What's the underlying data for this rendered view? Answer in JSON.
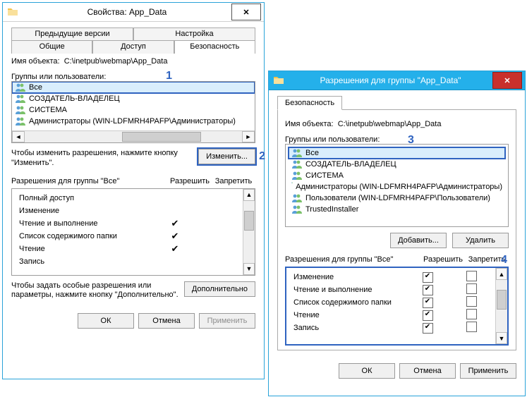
{
  "left": {
    "title": "Свойства: App_Data",
    "tabs_top": [
      "Предыдущие версии",
      "Настройка"
    ],
    "tabs_bottom": [
      "Общие",
      "Доступ",
      "Безопасность"
    ],
    "object_label": "Имя объекта:",
    "object_path": "C:\\inetpub\\webmap\\App_Data",
    "groups_label": "Группы или пользователи:",
    "groups": [
      "Все",
      "СОЗДАТЕЛЬ-ВЛАДЕЛЕЦ",
      "СИСТЕМА",
      "Администраторы (WIN-LDFMRH4PAFP\\Администраторы)"
    ],
    "change_note": "Чтобы изменить разрешения, нажмите кнопку \"Изменить\".",
    "change_btn": "Изменить...",
    "perm_label": "Разрешения для группы \"Все\"",
    "allow": "Разрешить",
    "deny": "Запретить",
    "perms": [
      {
        "name": "Полный доступ",
        "allow": false
      },
      {
        "name": "Изменение",
        "allow": false
      },
      {
        "name": "Чтение и выполнение",
        "allow": true
      },
      {
        "name": "Список содержимого папки",
        "allow": true
      },
      {
        "name": "Чтение",
        "allow": true
      },
      {
        "name": "Запись",
        "allow": false
      }
    ],
    "adv_note": "Чтобы задать особые разрешения или параметры, нажмите кнопку \"Дополнительно\".",
    "adv_btn": "Дополнительно",
    "ok": "ОК",
    "cancel": "Отмена",
    "apply": "Применить"
  },
  "right": {
    "title": "Разрешения для группы \"App_Data\"",
    "tab": "Безопасность",
    "object_label": "Имя объекта:",
    "object_path": "C:\\inetpub\\webmap\\App_Data",
    "groups_label": "Группы или пользователи:",
    "groups": [
      "Все",
      "СОЗДАТЕЛЬ-ВЛАДЕЛЕЦ",
      "СИСТЕМА",
      "Администраторы (WIN-LDFMRH4PAFP\\Администраторы)",
      "Пользователи (WIN-LDFMRH4PAFP\\Пользователи)",
      "TrustedInstaller"
    ],
    "add_btn": "Добавить...",
    "remove_btn": "Удалить",
    "perm_label": "Разрешения для группы \"Все\"",
    "allow": "Разрешить",
    "deny": "Запретить",
    "perms": [
      {
        "name": "Изменение",
        "allow": true,
        "deny": false
      },
      {
        "name": "Чтение и выполнение",
        "allow": true,
        "deny": false
      },
      {
        "name": "Список содержимого папки",
        "allow": true,
        "deny": false
      },
      {
        "name": "Чтение",
        "allow": true,
        "deny": false
      },
      {
        "name": "Запись",
        "allow": true,
        "deny": false
      }
    ],
    "ok": "ОК",
    "cancel": "Отмена",
    "apply": "Применить"
  },
  "annotations": {
    "a1": "1",
    "a2": "2",
    "a3": "3",
    "a4": "4"
  }
}
